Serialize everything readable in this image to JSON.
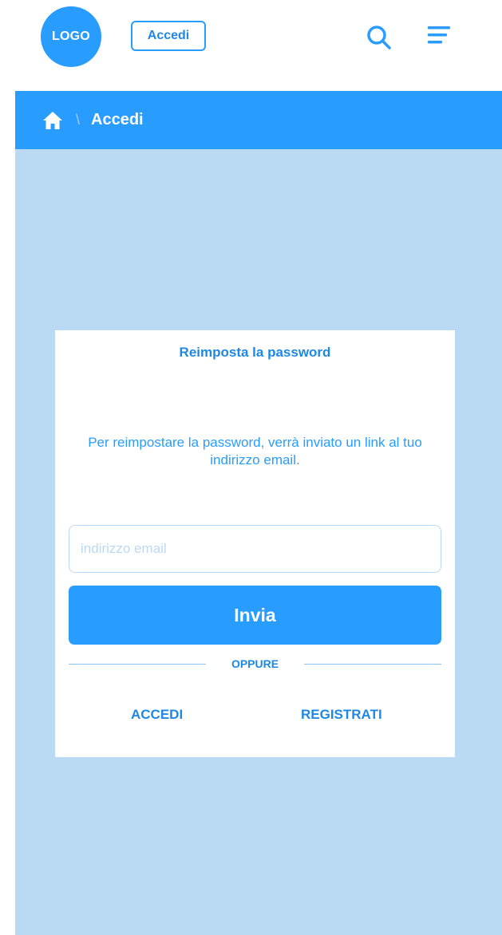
{
  "header": {
    "logo_text": "LOGO",
    "login_label": "Accedi",
    "search_icon": "search-icon",
    "menu_icon": "menu-icon"
  },
  "breadcrumb": {
    "home_icon": "home-icon",
    "separator": "\\",
    "current": "Accedi"
  },
  "reset_card": {
    "title": "Reimposta la password",
    "description": "Per reimpostare la password, verrà inviato un link al tuo indirizzo email.",
    "email_placeholder": "indirizzo email",
    "email_value": "",
    "submit_label": "Invia",
    "divider_text": "OPPURE",
    "login_link": "ACCEDI",
    "register_link": "REGISTRATI"
  },
  "colors": {
    "accent": "#299CFF",
    "accent_dark": "#1E88E5",
    "background": "#BADAF3",
    "card": "#FFFFFF"
  }
}
